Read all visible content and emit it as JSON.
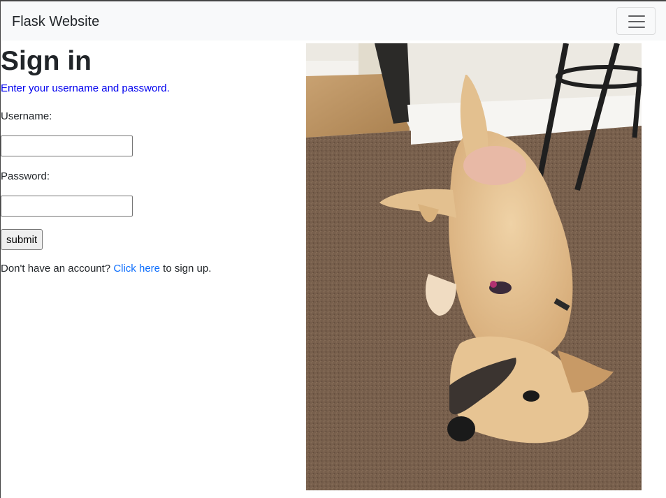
{
  "navbar": {
    "brand": "Flask Website",
    "toggler_icon": "hamburger-menu-icon"
  },
  "signin": {
    "title": "Sign in",
    "subtitle": "Enter your username and password.",
    "username_label": "Username:",
    "username_value": "",
    "password_label": "Password:",
    "password_value": "",
    "submit_label": "submit",
    "signup_prefix": "Don't have an account? ",
    "signup_link": "Click here",
    "signup_suffix": " to sign up."
  },
  "photo": {
    "subject": "dog-photo"
  },
  "colors": {
    "navbar_bg": "#f8f9fa",
    "subtitle": "#0000ee",
    "link": "#0d6efd",
    "text": "#212529"
  }
}
